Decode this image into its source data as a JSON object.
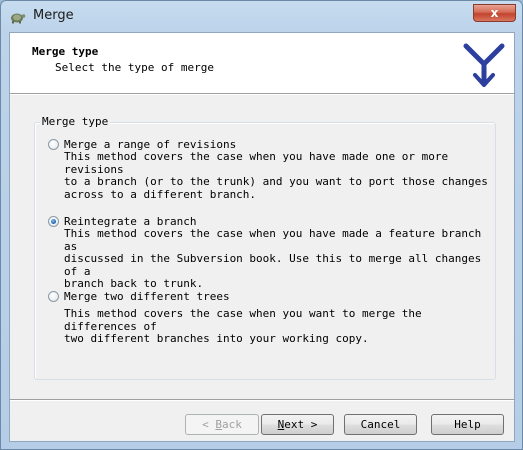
{
  "window": {
    "title": "Merge",
    "close_glyph": "x"
  },
  "header": {
    "title": "Merge type",
    "subtitle": "Select the type of merge"
  },
  "group": {
    "label": "Merge type"
  },
  "options": [
    {
      "label": "Merge a range of revisions",
      "checked": false,
      "description": "This method covers the case when you have made one or more revisions\nto a branch (or to the trunk) and you want to port those changes\nacross to a different branch."
    },
    {
      "label": "Reintegrate a branch",
      "checked": true,
      "description": "This method covers the case when you have made a feature branch as\ndiscussed in the Subversion book. Use this to merge all changes of a\nbranch back to trunk."
    },
    {
      "label": "Merge two different trees",
      "checked": false,
      "description": "This method covers the case when you want to merge the differences of\ntwo different branches into your working copy."
    }
  ],
  "buttons": {
    "back": {
      "prefix": "< ",
      "accel": "B",
      "rest": "ack",
      "enabled": false
    },
    "next": {
      "accel": "N",
      "rest": "ext >",
      "enabled": true
    },
    "cancel": {
      "label": "Cancel",
      "enabled": true
    },
    "help": {
      "label": "Help",
      "enabled": true
    }
  },
  "colors": {
    "logo_blue": "#2c3f9e",
    "title_bar": "#bcd3ea"
  },
  "icons": {
    "app": "tortoise-icon",
    "logo": "merge-logo-icon",
    "close": "close-icon"
  }
}
